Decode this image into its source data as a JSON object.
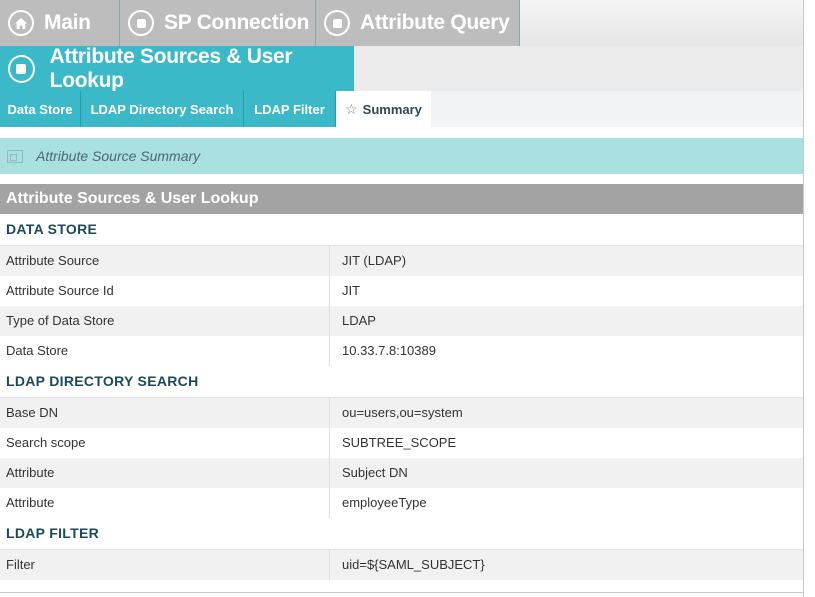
{
  "breadcrumbs": [
    {
      "label": "Main",
      "icon": "home-icon"
    },
    {
      "label": "SP Connection",
      "icon": "stop-circle-icon"
    },
    {
      "label": "Attribute Query",
      "icon": "stop-circle-icon"
    }
  ],
  "current_page": {
    "label": "Attribute Sources & User Lookup",
    "icon": "stop-circle-icon"
  },
  "subtabs": [
    {
      "label": "Data Store"
    },
    {
      "label": "LDAP Directory Search"
    },
    {
      "label": "LDAP Filter"
    },
    {
      "label": "Summary",
      "icon": "star-icon",
      "active": true
    }
  ],
  "summary_bar": {
    "label": "Attribute Source Summary",
    "icon": "window-icon"
  },
  "section": {
    "title": "Attribute Sources & User Lookup",
    "groups": [
      {
        "title": "DATA STORE",
        "rows": [
          {
            "key": "Attribute Source",
            "value": "JIT (LDAP)"
          },
          {
            "key": "Attribute Source Id",
            "value": "JIT"
          },
          {
            "key": "Type of Data Store",
            "value": "LDAP"
          },
          {
            "key": "Data Store",
            "value": "10.33.7.8:10389"
          }
        ]
      },
      {
        "title": "LDAP DIRECTORY SEARCH",
        "rows": [
          {
            "key": "Base DN",
            "value": "ou=users,ou=system"
          },
          {
            "key": "Search scope",
            "value": "SUBTREE_SCOPE"
          },
          {
            "key": "Attribute",
            "value": "Subject DN"
          },
          {
            "key": "Attribute",
            "value": "employeeType"
          }
        ]
      },
      {
        "title": "LDAP FILTER",
        "rows": [
          {
            "key": "Filter",
            "value": "uid=${SAML_SUBJECT}"
          }
        ]
      }
    ]
  },
  "colors": {
    "accent": "#3bb9c9",
    "breadcrumb_bg": "#bdbdbd",
    "summary_bg": "#abe0e0",
    "section_header_bg": "#a3a3a3",
    "group_title": "#1c4a5a"
  }
}
